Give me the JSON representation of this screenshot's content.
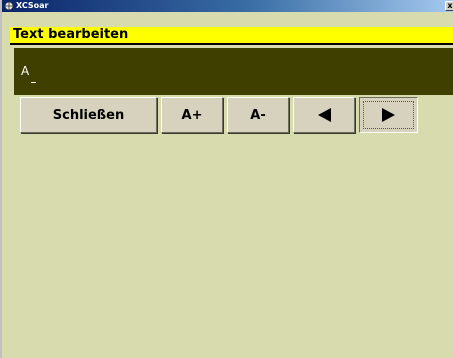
{
  "window": {
    "app_title": "XCSoar",
    "close_glyph": "x",
    "icon": "xcsoar-app-icon"
  },
  "dialog": {
    "title": "Text bearbeiten"
  },
  "editor": {
    "value": "A"
  },
  "buttons": {
    "close_label": "Schließen",
    "font_larger_label": "A+",
    "font_smaller_label": "A-",
    "left_icon": "arrow-left-icon",
    "right_icon": "arrow-right-icon"
  },
  "colors": {
    "background": "#d8dbae",
    "header": "#ffff00",
    "text_field": "#3f3f00",
    "button": "#d6d2bd"
  }
}
